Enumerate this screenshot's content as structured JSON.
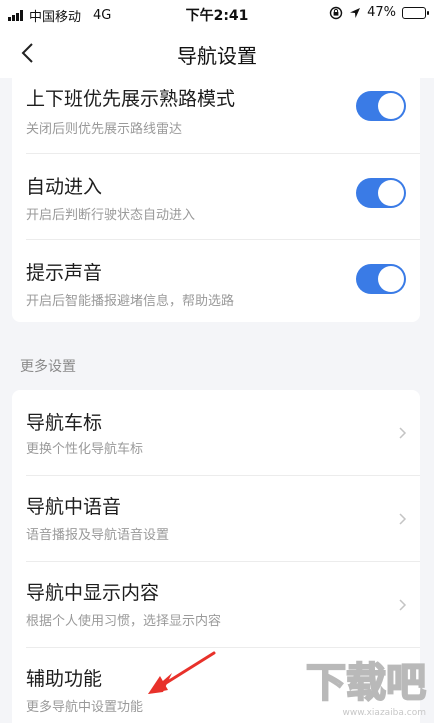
{
  "status_bar": {
    "carrier": "中国移动",
    "network": "4G",
    "time": "下午2:41",
    "battery": "47%",
    "battery_level": 0.47,
    "icons": [
      "signal-icon",
      "lock-rotation-icon",
      "location-icon",
      "battery-icon"
    ]
  },
  "nav": {
    "title": "导航设置",
    "back_icon": "chevron-left-icon"
  },
  "settings": [
    {
      "title": "上下班优先展示熟路模式",
      "subtitle": "关闭后则优先展示路线雷达",
      "enabled": true
    },
    {
      "title": "自动进入",
      "subtitle": "开启后判断行驶状态自动进入",
      "enabled": true
    },
    {
      "title": "提示声音",
      "subtitle": "开启后智能播报避堵信息，帮助选路",
      "enabled": true
    }
  ],
  "more": {
    "label": "更多设置",
    "items": [
      {
        "title": "导航车标",
        "subtitle": "更换个性化导航车标"
      },
      {
        "title": "导航中语音",
        "subtitle": "语音播报及导航语音设置"
      },
      {
        "title": "导航中显示内容",
        "subtitle": "根据个人使用习惯，选择显示内容"
      },
      {
        "title": "辅助功能",
        "subtitle": "更多导航中设置功能"
      }
    ]
  },
  "watermark": {
    "text": "下载吧",
    "url": "www.xiazaiba.com"
  },
  "colors": {
    "accent": "#3a7be6",
    "annotation": "#e8312a",
    "background": "#f4f5f8"
  }
}
